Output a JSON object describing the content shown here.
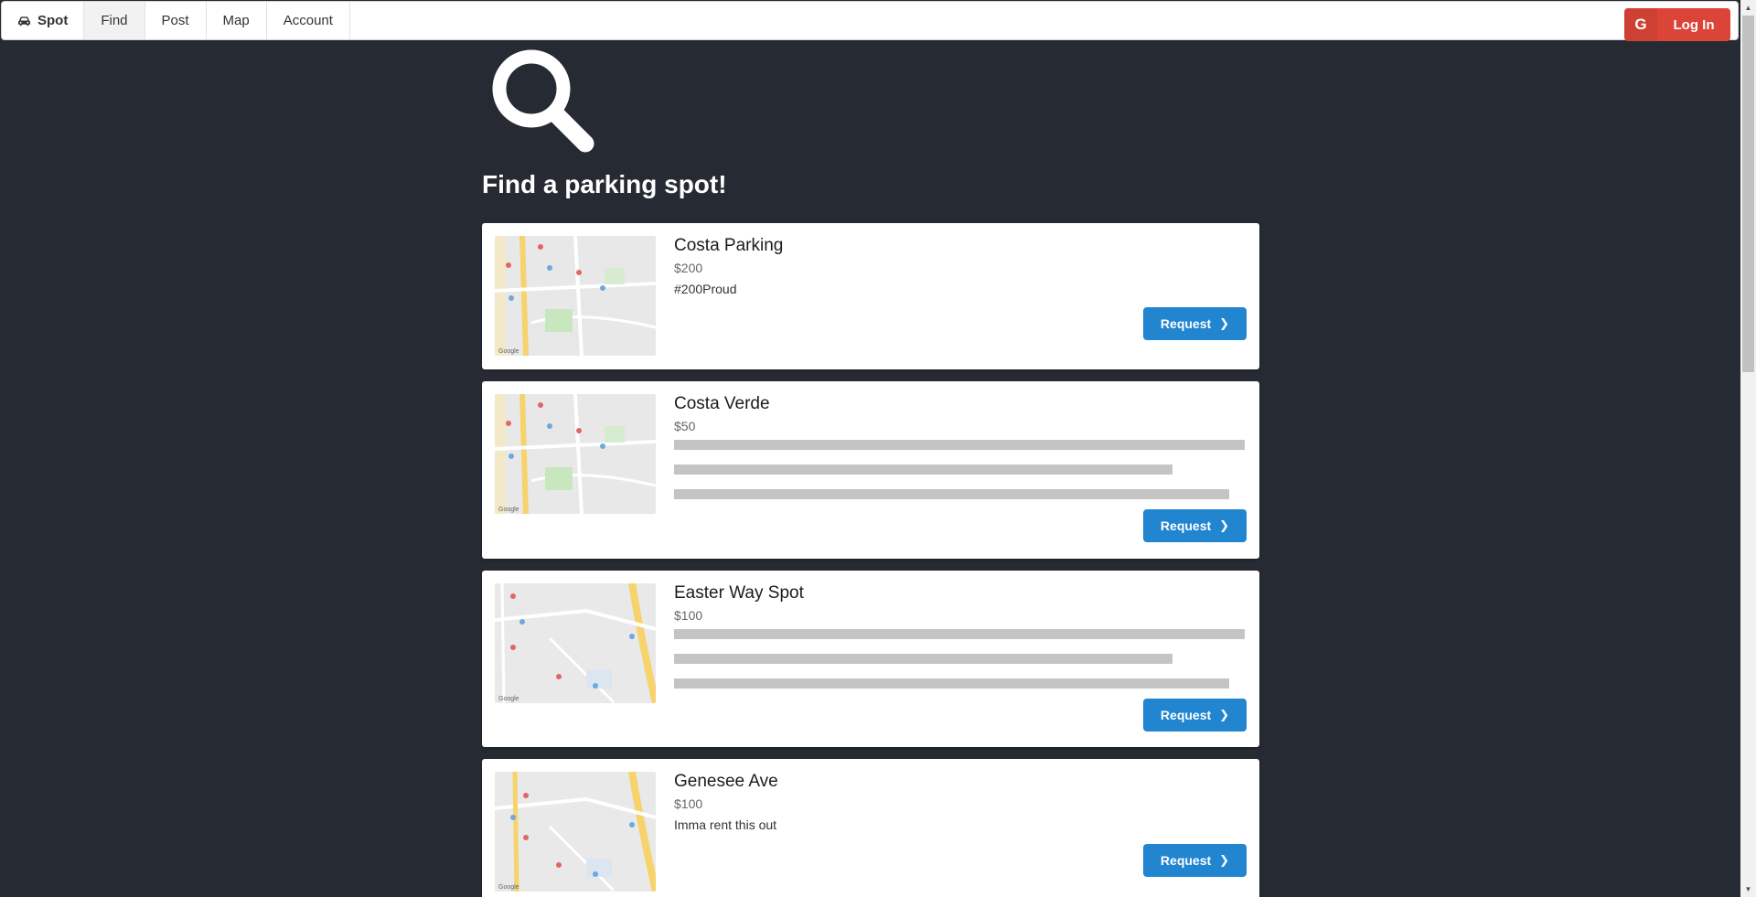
{
  "nav": {
    "brand": "Spot",
    "items": [
      {
        "label": "Find",
        "active": true
      },
      {
        "label": "Post",
        "active": false
      },
      {
        "label": "Map",
        "active": false
      },
      {
        "label": "Account",
        "active": false
      }
    ],
    "login_label": "Log In",
    "login_icon_text": "G"
  },
  "page": {
    "title": "Find a parking spot!"
  },
  "listings": [
    {
      "name": "Costa Parking",
      "price": "$200",
      "description": "#200Proud",
      "map": "map-a"
    },
    {
      "name": "Costa Verde",
      "price": "$50",
      "description": "",
      "map": "map-a"
    },
    {
      "name": "Easter Way Spot",
      "price": "$100",
      "description": "",
      "map": "map-b"
    },
    {
      "name": "Genesee Ave",
      "price": "$100",
      "description": "Imma rent this out",
      "map": "map-b"
    }
  ],
  "request_label": "Request",
  "colors": {
    "background": "#262a33",
    "request_button": "#2185d0",
    "login_button": "#db4437"
  }
}
